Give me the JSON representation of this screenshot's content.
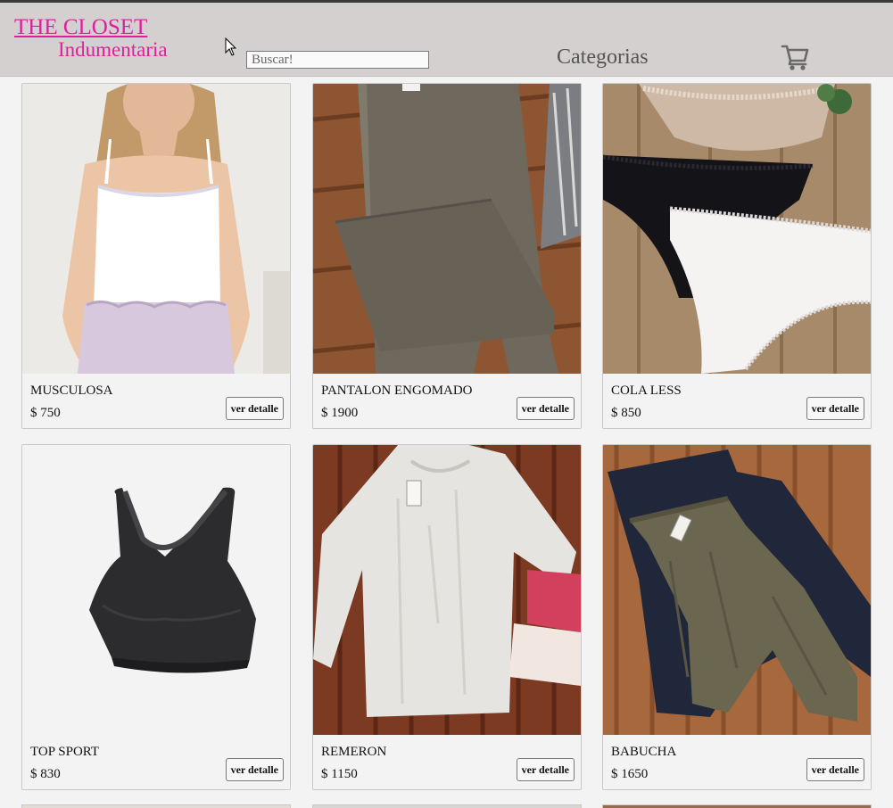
{
  "header": {
    "brand_main": "THE CLOSET",
    "brand_sub": "Indumentaria",
    "search_placeholder": "Buscar!",
    "categories_label": "Categorias",
    "brand_color": "#e01f9c"
  },
  "products": [
    {
      "name": "MUSCULOSA",
      "price": "$ 750",
      "button": "ver detalle"
    },
    {
      "name": "PANTALON ENGOMADO",
      "price": "$ 1900",
      "button": "ver detalle"
    },
    {
      "name": "COLA LESS",
      "price": "$ 850",
      "button": "ver detalle"
    },
    {
      "name": "TOP SPORT",
      "price": "$ 830",
      "button": "ver detalle"
    },
    {
      "name": "REMERON",
      "price": "$ 1150",
      "button": "ver detalle"
    },
    {
      "name": "BABUCHA",
      "price": "$ 1650",
      "button": "ver detalle"
    }
  ],
  "icons": {
    "cart": "cart-icon",
    "cursor": "mouse-pointer-icon"
  }
}
